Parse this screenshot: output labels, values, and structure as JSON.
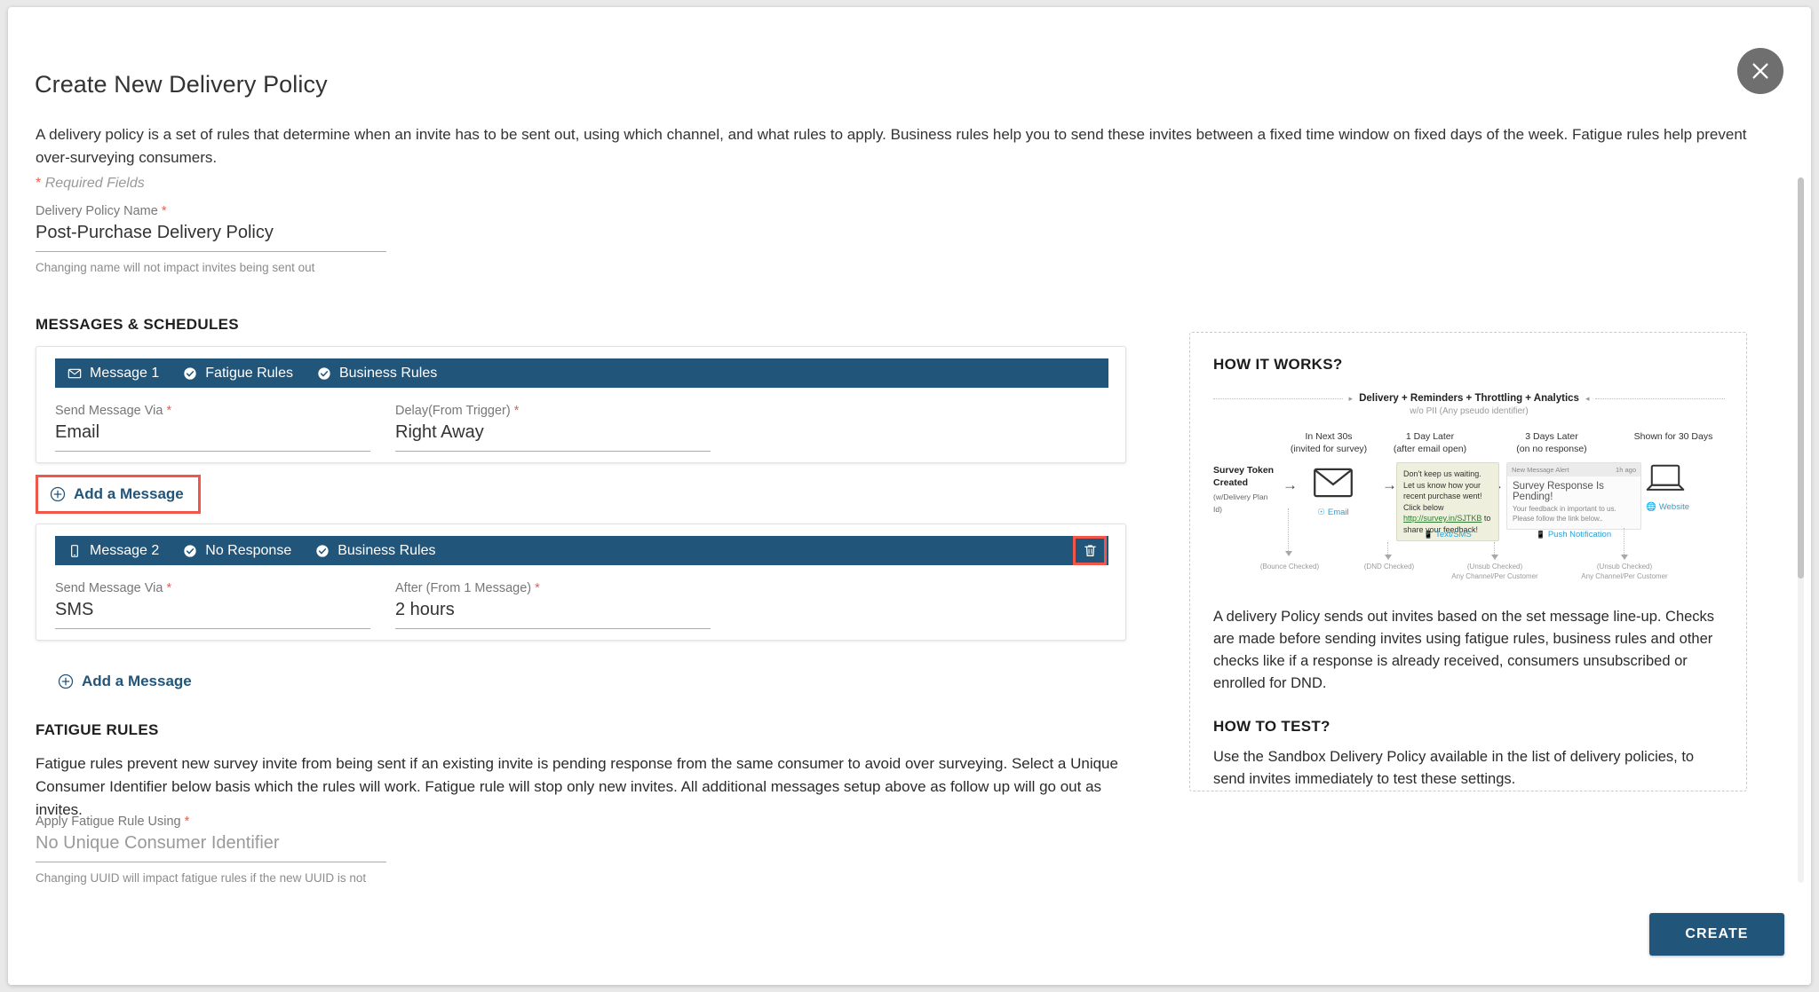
{
  "modal": {
    "title": "Create New Delivery Policy",
    "description": "A delivery policy is a set of rules that determine when an invite has to be sent out, using which channel, and what rules to apply. Business rules help you to send these invites between a fixed time window on fixed days of the week. Fatigue rules help prevent over-surveying consumers.",
    "required_note": "Required Fields",
    "close_icon": "close-icon"
  },
  "policy_name": {
    "label": "Delivery Policy Name",
    "value": "Post-Purchase Delivery Policy",
    "help": "Changing name will not impact invites being sent out",
    "required": true
  },
  "messages_section": {
    "heading": "MESSAGES & SCHEDULES",
    "add_message_label": "Add a Message",
    "messages": [
      {
        "channel_icon": "envelope-icon",
        "title": "Message 1",
        "tags": [
          "Fatigue Rules",
          "Business Rules"
        ],
        "deletable": false,
        "fields": [
          {
            "label": "Send Message Via",
            "value": "Email",
            "required": true
          },
          {
            "label": "Delay(From Trigger)",
            "value": "Right Away",
            "required": true
          }
        ]
      },
      {
        "channel_icon": "mobile-icon",
        "title": "Message 2",
        "tags": [
          "No Response",
          "Business Rules"
        ],
        "deletable": true,
        "delete_icon": "trash-icon",
        "fields": [
          {
            "label": "Send Message Via",
            "value": "SMS",
            "required": true
          },
          {
            "label": "After (From 1 Message)",
            "value": "2 hours",
            "required": true
          }
        ]
      }
    ]
  },
  "fatigue_section": {
    "heading": "FATIGUE RULES",
    "description": "Fatigue rules prevent new survey invite from being sent if an existing invite is pending response from the same consumer to avoid over surveying. Select a Unique Consumer Identifier below basis which the rules will work. Fatigue rule will stop only new invites. All additional messages setup above as follow up will go out as invites.",
    "uuid_field": {
      "label": "Apply Fatigue Rule Using",
      "value": "No Unique Consumer Identifier",
      "is_placeholder": true,
      "help": "Changing UUID will impact fatigue rules if the new UUID is not available in past responses from consumers",
      "required": true
    }
  },
  "how_it_works": {
    "title": "HOW IT WORKS?",
    "body": "A delivery Policy sends out invites based on the set message line-up. Checks are made before sending invites using fatigue rules, business rules and other checks like if a response is already received, consumers unsubscribed or enrolled for DND.",
    "test_title": "HOW TO TEST?",
    "test_body": "Use the Sandbox Delivery Policy available in the list of delivery policies, to send invites immediately to test these settings.",
    "diagram": {
      "banner": "Delivery + Reminders + Throttling + Analytics",
      "banner_sub": "w/o PII (Any pseudo identifier)",
      "start_title": "Survey Token Created",
      "start_sub": "(w/Delivery Plan Id)",
      "steps": [
        {
          "time": "In Next 30s",
          "condition": "(invited for survey)",
          "channel": "Email",
          "channel_icon": "envelope-icon",
          "footnote": "(Bounce Checked)"
        },
        {
          "time": "1 Day Later",
          "condition": "(after email open)",
          "channel": "Text/SMS",
          "channel_icon": "mobile-icon",
          "footnote": "(DND Checked)",
          "sms_text_1": "Don't keep us waiting. Let us know how your recent purchase went! Click below",
          "sms_link": "http://survey.in/SJTKB",
          "sms_text_2": "to share your feedback!"
        },
        {
          "time": "3 Days Later",
          "condition": "(on no response)",
          "channel": "Push Notification",
          "channel_icon": "mobile-icon",
          "footnote": "(Unsub Checked)",
          "footnote2": "Any Channel/Per Customer",
          "push_header": "New Message Alert",
          "push_time": "1h ago",
          "push_title": "Survey Response Is Pending!",
          "push_body": "Your feedback in important to us. Please follow the link below.."
        },
        {
          "time": "Shown for 30 Days",
          "condition": "",
          "channel": "Website",
          "channel_icon": "globe-icon",
          "footnote": "(Unsub Checked)",
          "footnote2": "Any Channel/Per Customer"
        }
      ]
    }
  },
  "footer": {
    "create_label": "CREATE"
  },
  "colors": {
    "accent": "#22557a",
    "required": "#e8604c",
    "highlight": "#f0564a"
  }
}
